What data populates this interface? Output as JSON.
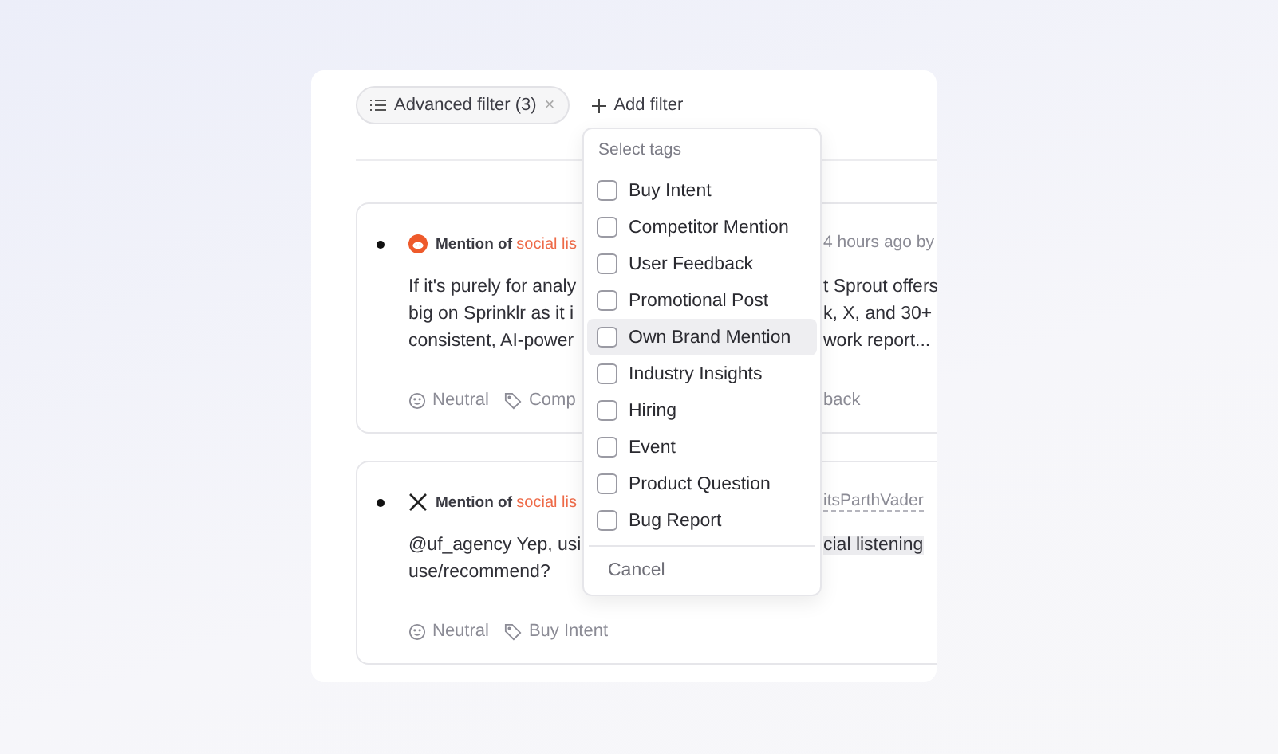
{
  "filter_bar": {
    "advanced_filter": {
      "label": "Advanced filter (3)",
      "remove": "×"
    },
    "add_filter": "Add filter"
  },
  "mentions": [
    {
      "kind": "reddit",
      "prefix": "Mention of",
      "keyword": "social lis",
      "meta": "4 hours ago by",
      "lines_left": [
        "If it's purely for analy",
        "big on Sprinklr as it i",
        "consistent, AI-power"
      ],
      "lines_right": [
        "t Sprout offers",
        "k, X, and 30+",
        "work report..."
      ],
      "tags_left": [
        {
          "kind": "sentiment",
          "label": "Neutral"
        },
        {
          "kind": "tag",
          "label": "Comp"
        }
      ],
      "tags_right": "back",
      "highlight_right": false
    },
    {
      "kind": "x",
      "prefix": "Mention of",
      "keyword": "social lis",
      "meta": "itsParthVader",
      "lines_left": [
        "@uf_agency Yep, usi",
        "use/recommend?"
      ],
      "lines_right": [
        "cial listening"
      ],
      "tags_left": [
        {
          "kind": "sentiment",
          "label": "Neutral"
        },
        {
          "kind": "tag",
          "label": "Buy Intent"
        }
      ],
      "highlight_right": true
    }
  ],
  "tag_menu": {
    "title": "Select tags",
    "items": [
      {
        "label": "Buy Intent",
        "checked": false,
        "highlighted": false
      },
      {
        "label": "Competitor Mention",
        "checked": false,
        "highlighted": false
      },
      {
        "label": "User Feedback",
        "checked": false,
        "highlighted": false
      },
      {
        "label": "Promotional Post",
        "checked": false,
        "highlighted": false
      },
      {
        "label": "Own Brand Mention",
        "checked": false,
        "highlighted": true
      },
      {
        "label": "Industry Insights",
        "checked": false,
        "highlighted": false
      },
      {
        "label": "Hiring",
        "checked": false,
        "highlighted": false
      },
      {
        "label": "Event",
        "checked": false,
        "highlighted": false
      },
      {
        "label": "Product Question",
        "checked": false,
        "highlighted": false
      },
      {
        "label": "Bug Report",
        "checked": false,
        "highlighted": false
      }
    ],
    "cancel": "Cancel"
  }
}
